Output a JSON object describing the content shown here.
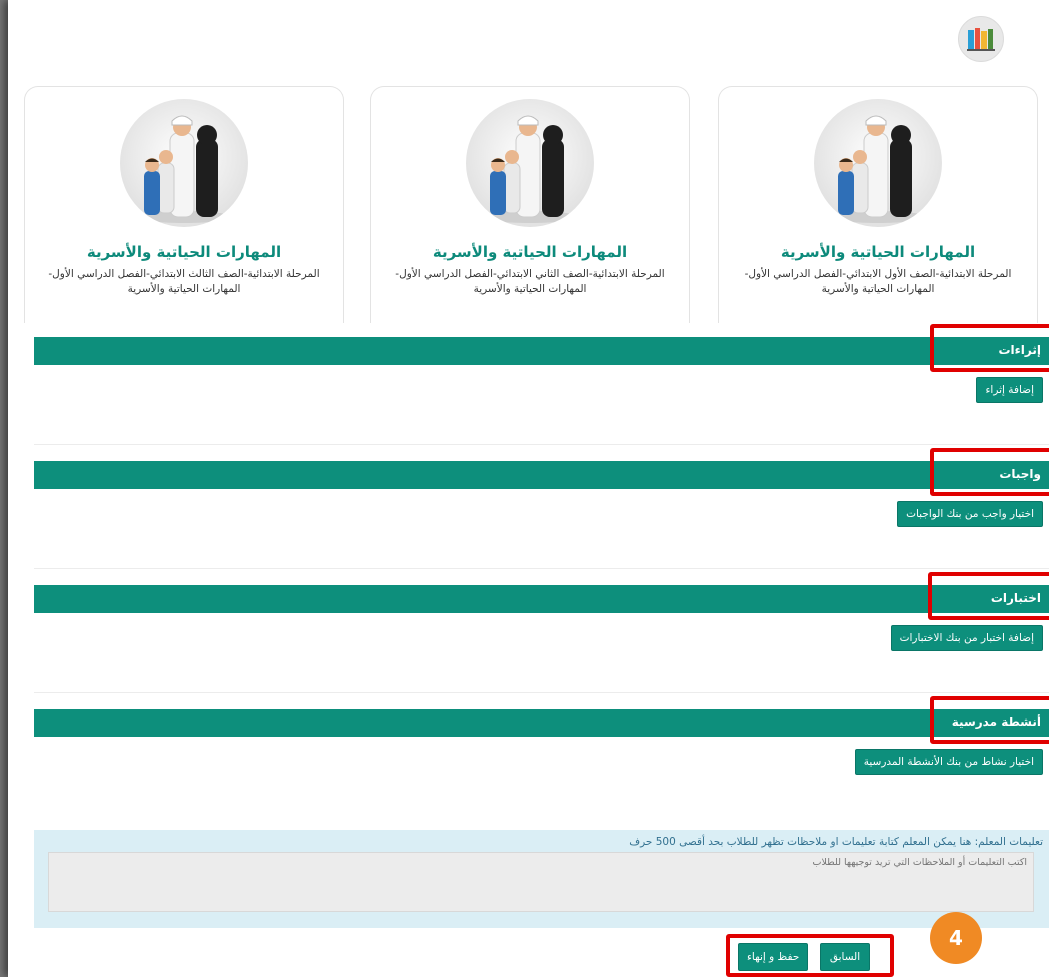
{
  "logo": {
    "icon": "books-icon"
  },
  "cards": [
    {
      "title": "المهارات الحياتية والأسرية",
      "description": "المرحلة الابتدائية-الصف الثالث الابتدائي-الفصل الدراسي الأول-المهارات الحياتية والأسرية"
    },
    {
      "title": "المهارات الحياتية والأسرية",
      "description": "المرحلة الابتدائية-الصف الثاني الابتدائي-الفصل الدراسي الأول-المهارات الحياتية والأسرية"
    },
    {
      "title": "المهارات الحياتية والأسرية",
      "description": "المرحلة الابتدائية-الصف الأول الابتدائي-الفصل الدراسي الأول-المهارات الحياتية والأسرية"
    }
  ],
  "sections": {
    "enrichments": {
      "title": "إثراءات",
      "button": "إضافة إثراء"
    },
    "homework": {
      "title": "واجبات",
      "button": "اختيار واجب من بنك الواجبات"
    },
    "tests": {
      "title": "اختبارات",
      "button": "إضافة اختبار من بنك الاختبارات"
    },
    "activities": {
      "title": "أنشطة مدرسية",
      "button": "اختيار نشاط من بنك الأنشطة المدرسية"
    }
  },
  "notes": {
    "label": "تعليمات المعلم: هنا يمكن المعلم كتابة تعليمات او ملاحظات تظهر للطلاب بحد أقصى 500 حرف",
    "placeholder": "اكتب التعليمات أو الملاحظات التي تريد توجيهها للطلاب"
  },
  "footer": {
    "save_finish": "حفظ و إنهاء",
    "previous": "السابق"
  },
  "badge": {
    "number": "4"
  },
  "colors": {
    "accent": "#0d8f7c",
    "title": "#0d8a7b",
    "highlight": "#e00000",
    "badge": "#f08a24"
  }
}
